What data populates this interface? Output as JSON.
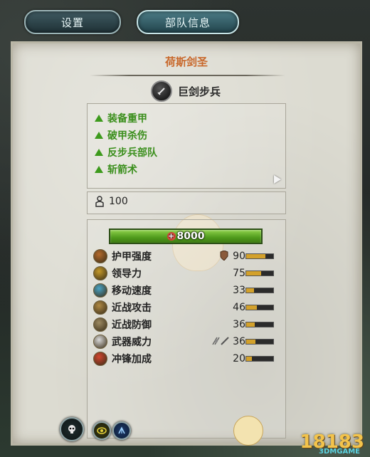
{
  "tabs": {
    "settings": "设置",
    "unit_info": "部队信息"
  },
  "unit": {
    "name": "荷斯剑圣",
    "type": "巨剑步兵"
  },
  "abilities": [
    "装备重甲",
    "破甲杀伤",
    "反步兵部队",
    "斩箭术"
  ],
  "men_count": "100",
  "health": {
    "value": "8000",
    "plus_symbol": "+"
  },
  "stats": [
    {
      "label": "护甲强度",
      "value": "90",
      "bar_fraction": 0.7,
      "icon": "armor-icon",
      "color": "#b56b2c"
    },
    {
      "label": "领导力",
      "value": "75",
      "bar_fraction": 0.55,
      "icon": "leadership-icon",
      "color": "#c59a2a"
    },
    {
      "label": "移动速度",
      "value": "33",
      "bar_fraction": 0.3,
      "icon": "speed-icon",
      "color": "#4aa3c4"
    },
    {
      "label": "近战攻击",
      "value": "46",
      "bar_fraction": 0.4,
      "icon": "melee-attack-icon",
      "color": "#b08a45"
    },
    {
      "label": "近战防御",
      "value": "36",
      "bar_fraction": 0.32,
      "icon": "melee-defense-icon",
      "color": "#9d8a62"
    },
    {
      "label": "武器威力",
      "value": "36",
      "bar_fraction": 0.35,
      "icon": "weapon-strength-icon",
      "color": "#d9d9d9"
    },
    {
      "label": "冲锋加成",
      "value": "20",
      "bar_fraction": 0.2,
      "icon": "charge-bonus-icon",
      "color": "#d2452f"
    }
  ],
  "watermark": {
    "brand": "18183",
    "sub": "3DMGAME"
  },
  "colors": {
    "title": "#c8672a",
    "ability_green": "#3b8f1d",
    "bar_fill": "#d3a12b"
  }
}
